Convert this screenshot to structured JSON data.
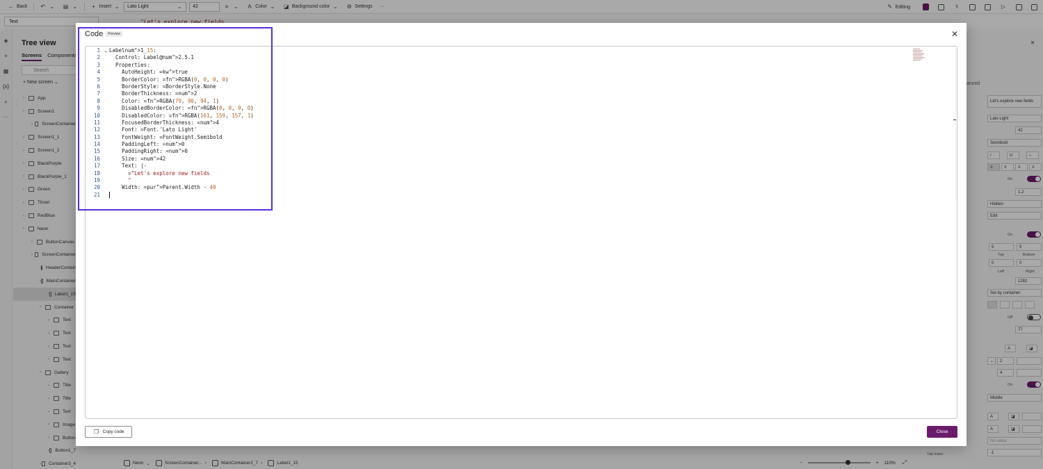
{
  "toolbar": {
    "back_label": "Back",
    "insert_label": "Insert",
    "font_name": "Lato Light",
    "font_size": "42",
    "color_label": "Color",
    "background_label": "Background color",
    "settings_label": "Settings",
    "more_label": "···",
    "editing_label": "Editing"
  },
  "formula_bar": {
    "property": "Text",
    "formula_text": "\"Let's explore new fields"
  },
  "tree": {
    "title": "Tree view",
    "tabs": [
      "Screens",
      "Components"
    ],
    "search_placeholder": "Search",
    "new_screen_label": "New screen",
    "items": [
      {
        "label": "App",
        "indent": 0
      },
      {
        "label": "Screen1",
        "indent": 0
      },
      {
        "label": "ScreenContainer",
        "indent": 1
      },
      {
        "label": "Screen1_1",
        "indent": 0
      },
      {
        "label": "Screen1_2",
        "indent": 0
      },
      {
        "label": "BlackPurple",
        "indent": 0
      },
      {
        "label": "BlackPurple_1",
        "indent": 0
      },
      {
        "label": "Green",
        "indent": 0
      },
      {
        "label": "Tinsel",
        "indent": 0
      },
      {
        "label": "RedBlue",
        "indent": 0
      },
      {
        "label": "Neon",
        "indent": 0
      },
      {
        "label": "ButtonCanvas",
        "indent": 1
      },
      {
        "label": "ScreenContainer",
        "indent": 1
      },
      {
        "label": "HeaderContainer",
        "indent": 2
      },
      {
        "label": "MainContainer",
        "indent": 2
      },
      {
        "label": "Label1_15",
        "indent": 3,
        "selected": true
      },
      {
        "label": "Container",
        "indent": 2
      },
      {
        "label": "Text",
        "indent": 3
      },
      {
        "label": "Text",
        "indent": 3
      },
      {
        "label": "Text",
        "indent": 3
      },
      {
        "label": "Text",
        "indent": 3
      },
      {
        "label": "Gallery",
        "indent": 2
      },
      {
        "label": "Title",
        "indent": 3
      },
      {
        "label": "Title",
        "indent": 3
      },
      {
        "label": "Text",
        "indent": 3
      },
      {
        "label": "Image",
        "indent": 3
      },
      {
        "label": "Button",
        "indent": 3
      },
      {
        "label": "Button1_7",
        "indent": 3
      },
      {
        "label": "Container3_4",
        "indent": 2
      }
    ]
  },
  "props": {
    "advanced_label": "anced",
    "text_value": "Let's explore new fields",
    "font": "Lato Light",
    "size": "42",
    "weight": "Semibold",
    "toggle_on": "On",
    "line_height": "1.2",
    "overflow": "Hidden",
    "mode": "Edit",
    "toggle_on2": "On",
    "pad_top": "5",
    "pad_bottom": "5",
    "pad_top_label": "Top",
    "pad_bottom_label": "Bottom",
    "pad_left": "0",
    "pad_right": "0",
    "pad_left_label": "Left",
    "pad_right_label": "Right",
    "width": "1282",
    "align_in_container": "Set by container",
    "toggle_off": "Off",
    "height": "77",
    "border_thickness": "2",
    "focused_thickness": "4",
    "toggle_on3": "On",
    "vertical_align": "Middle",
    "no_value": "No value",
    "tab_index_label": "Tab index",
    "tab_index": "-1"
  },
  "statusbar": {
    "crumbs": [
      "Neon",
      "ScreenContainer...",
      "MainContainer2_7",
      "Label1_15"
    ],
    "zoom": "110%"
  },
  "modal": {
    "title": "Code",
    "badge": "Preview",
    "copy_label": "Copy code",
    "close_label": "Close"
  },
  "code_lines": [
    "Label1_15:",
    "  Control: Label@2.5.1",
    "  Properties:",
    "    AutoHeight: =true",
    "    BorderColor: =RGBA(0, 0, 0, 0)",
    "    BorderStyle: =BorderStyle.None",
    "    BorderThickness: =2",
    "    Color: =RGBA(79, 90, 94, 1)",
    "    DisabledBorderColor: =RGBA(0, 0, 0, 0)",
    "    DisabledColor: =RGBA(161, 159, 157, 1)",
    "    FocusedBorderThickness: =4",
    "    Font: =Font.'Lato Light'",
    "    FontWeight: =FontWeight.Semibold",
    "    PaddingLeft: =0",
    "    PaddingRight: =0",
    "    Size: =42",
    "    Text: |-",
    "      =\"Let's explore new fields",
    "      \"",
    "    Width: =Parent.Width - 40",
    ""
  ],
  "colors": {
    "accent": "#6b1b6b",
    "highlight": "#5b2be0"
  }
}
